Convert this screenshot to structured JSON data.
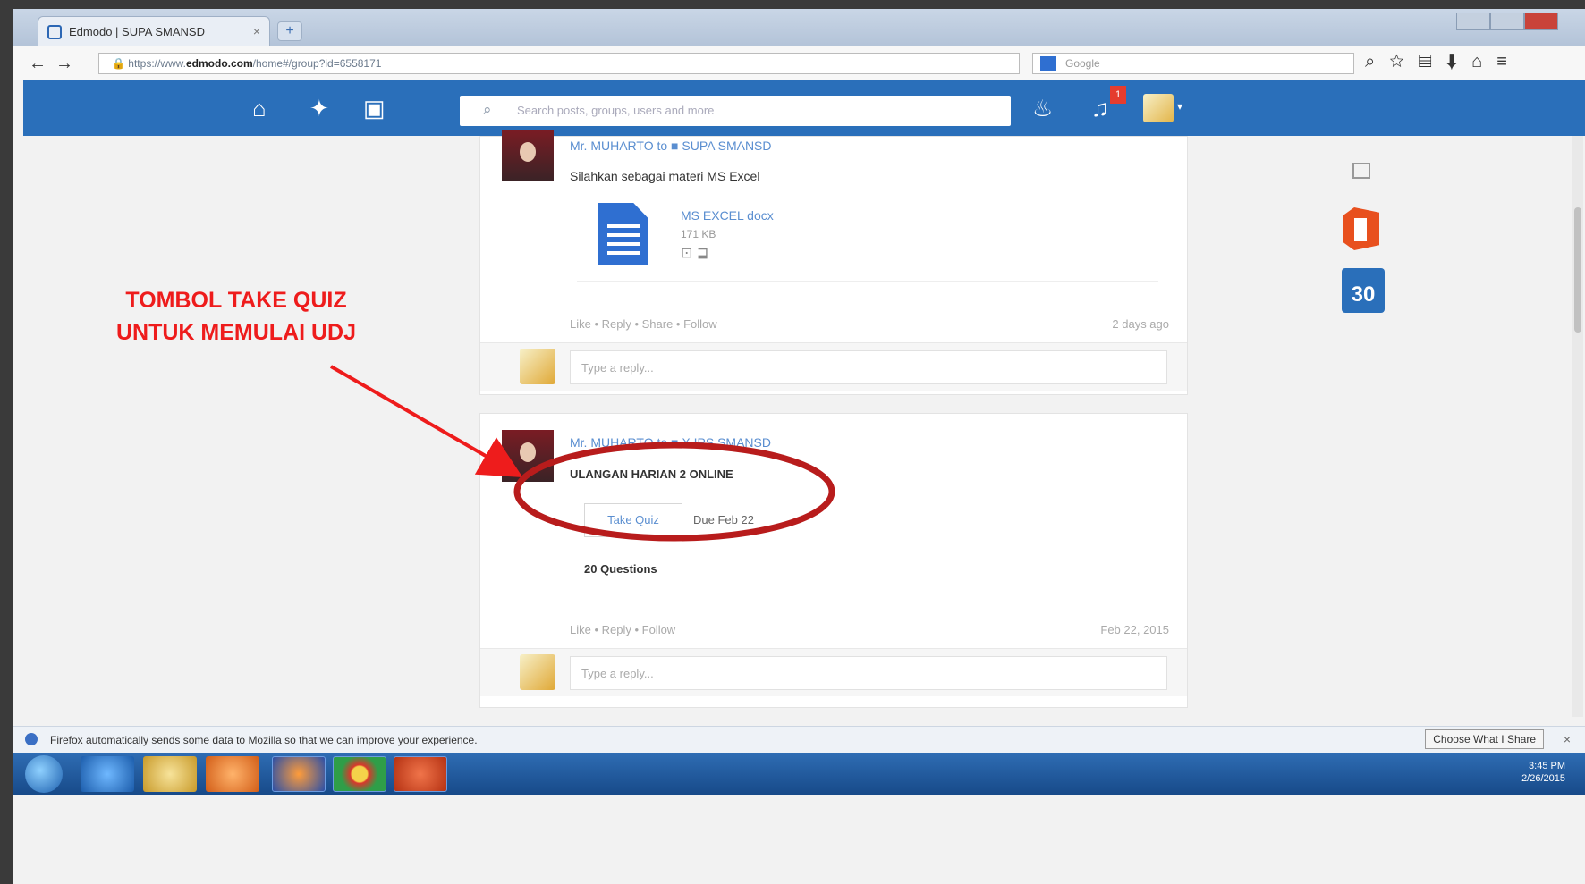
{
  "browser": {
    "tab_title": "Edmodo | SUPA SMANSD",
    "new_tab": "+",
    "tab_close": "×",
    "url_prefix": "https://www.",
    "url_domain": "edmodo.com",
    "url_path": "/home#/group?id=6558171",
    "search_placeholder": "Google",
    "back": "←",
    "forward": "→",
    "lock": "🔒"
  },
  "edmodo_header": {
    "search_placeholder": "Search posts, groups, users and more",
    "notification_count": "1"
  },
  "posts": [
    {
      "author": "Mr. MUHARTO to ■ SUPA SMANSD",
      "text": "Silahkan sebagai materi MS Excel",
      "attachment": {
        "name": "MS EXCEL docx",
        "size": "171 KB",
        "actions": "⊡ ⊒"
      },
      "actions": "Like • Reply • Share • Follow",
      "timestamp": "2 days ago",
      "reply_placeholder": "Type a reply..."
    },
    {
      "author": "Mr. MUHARTO to ■ X IPS SMANSD",
      "text": "ULANGAN HARIAN 2 ONLINE",
      "quiz_button": "Take Quiz",
      "due": "Due Feb 22",
      "question_count": "20 Questions",
      "actions": "Like • Reply • Follow",
      "timestamp": "Feb 22, 2015",
      "reply_placeholder": "Type a reply..."
    }
  ],
  "right_rail": {
    "calendar_day": "30"
  },
  "annotation": {
    "line1": "TOMBOL TAKE QUIZ",
    "line2": "UNTUK MEMULAI UDJ",
    "color": "#ee1c1c",
    "circle_color": "#b81c1c"
  },
  "notification_bar": {
    "text": "Firefox automatically sends some data to Mozilla so that we can improve your experience.",
    "button": "Choose What I Share",
    "close": "×"
  },
  "taskbar": {
    "time": "3:45 PM",
    "date": "2/26/2015"
  }
}
